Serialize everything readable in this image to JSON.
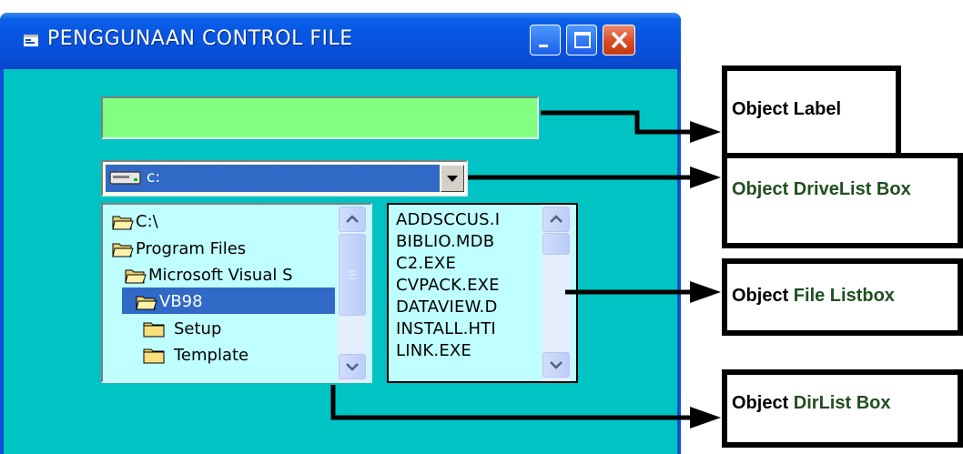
{
  "window": {
    "title": "PENGGUNAAN CONTROL FILE",
    "colors": {
      "client_bg": "#00c3c3",
      "label_bg": "#80ff80",
      "list_bg": "#c0ffff",
      "selection": "#3169c6"
    },
    "title_buttons": [
      "minimize-icon",
      "maximize-icon",
      "close-icon"
    ]
  },
  "drive": {
    "value": "c:",
    "icon": "drive-icon"
  },
  "dirlist": {
    "items": [
      {
        "label": "C:\\",
        "icon": "folder-open-icon"
      },
      {
        "label": "Program Files",
        "icon": "folder-open-icon"
      },
      {
        "label": "Microsoft Visual S",
        "icon": "folder-open-icon"
      },
      {
        "label": "VB98",
        "icon": "folder-open-icon",
        "selected": true
      },
      {
        "label": "Setup",
        "icon": "folder-icon"
      },
      {
        "label": "Template",
        "icon": "folder-icon"
      }
    ]
  },
  "filelist": {
    "items": [
      "ADDSCCUS.I",
      "BIBLIO.MDB",
      "C2.EXE",
      "CVPACK.EXE",
      "DATAVIEW.D",
      "INSTALL.HTI",
      "LINK.EXE"
    ]
  },
  "annotations": {
    "label_box": {
      "prefix": "Object ",
      "name": "Label"
    },
    "drive_box": {
      "prefix": "Object DriveList Box",
      "name": ""
    },
    "file_box": {
      "prefix": "Object ",
      "name": "File Listbox"
    },
    "dir_box": {
      "prefix": "Object ",
      "name": "DirList Box"
    }
  }
}
